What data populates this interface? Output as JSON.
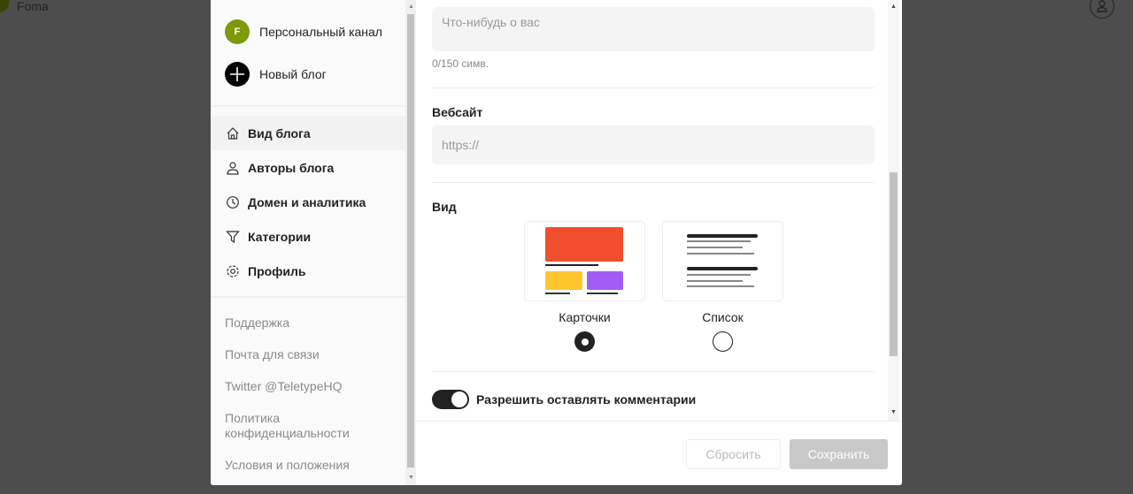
{
  "topbar": {
    "username": "Foma"
  },
  "sidebar": {
    "channels": [
      {
        "label": "Персональный канал",
        "initial": "F",
        "color": "#7d9a0a"
      },
      {
        "label": "Новый блог"
      }
    ],
    "nav": [
      {
        "label": "Вид блога",
        "icon": "home-icon"
      },
      {
        "label": "Авторы блога",
        "icon": "users-icon"
      },
      {
        "label": "Домен и аналитика",
        "icon": "analytics-icon"
      },
      {
        "label": "Категории",
        "icon": "filter-icon"
      },
      {
        "label": "Профиль",
        "icon": "gear-icon"
      }
    ],
    "links": [
      "Поддержка",
      "Почта для связи",
      "Twitter @TeletypeHQ",
      "Политика конфиденциальности",
      "Условия и положения"
    ]
  },
  "main": {
    "about_placeholder": "Что-нибудь о вас",
    "char_count": "0/150 симв.",
    "website_label": "Вебсайт",
    "website_placeholder": "https://",
    "view_label": "Вид",
    "view_options": [
      {
        "label": "Карточки",
        "selected": true
      },
      {
        "label": "Список",
        "selected": false
      }
    ],
    "comments_label": "Разрешить оставлять комментарии",
    "comments_enabled": true
  },
  "footer": {
    "reset": "Сбросить",
    "save": "Сохранить"
  }
}
